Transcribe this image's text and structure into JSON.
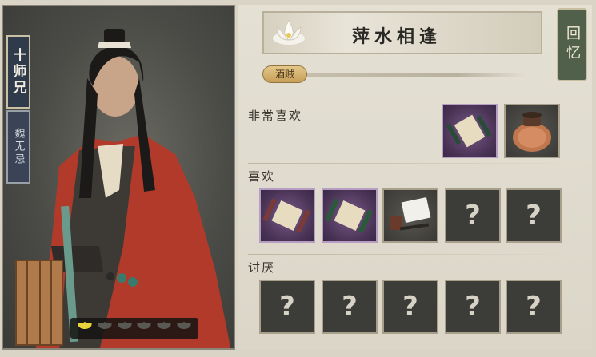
{
  "character": {
    "title": "十师兄",
    "name": "魏无忌",
    "favor_leaves_filled": 1,
    "favor_leaves_total": 6
  },
  "header": {
    "title": "萍水相逢",
    "recall_button": "回忆"
  },
  "relationship": {
    "tag": "酒贼",
    "progress": 0.0
  },
  "sections": {
    "love_label": "非常喜欢",
    "like_label": "喜欢",
    "dislike_label": "讨厌"
  },
  "items": {
    "love": [
      {
        "icon": "scroll-icon",
        "rarity": "purple"
      },
      {
        "icon": "wine-jar-icon",
        "rarity": "dark"
      }
    ],
    "like": [
      {
        "icon": "scroll-icon",
        "rarity": "purple"
      },
      {
        "icon": "scroll-green-icon",
        "rarity": "purple"
      },
      {
        "icon": "paper-brush-icon",
        "rarity": "dark"
      },
      {
        "icon": "unknown",
        "rarity": "empty",
        "text": "?"
      },
      {
        "icon": "unknown",
        "rarity": "empty",
        "text": "?"
      }
    ],
    "dislike": [
      {
        "icon": "unknown",
        "rarity": "empty",
        "text": "?"
      },
      {
        "icon": "unknown",
        "rarity": "empty",
        "text": "?"
      },
      {
        "icon": "unknown",
        "rarity": "empty",
        "text": "?"
      },
      {
        "icon": "unknown",
        "rarity": "empty",
        "text": "?"
      },
      {
        "icon": "unknown",
        "rarity": "empty",
        "text": "?"
      }
    ]
  },
  "colors": {
    "accent_gold": "#c79f58",
    "recall_green": "#51604a",
    "rare_purple": "#4a3456"
  }
}
